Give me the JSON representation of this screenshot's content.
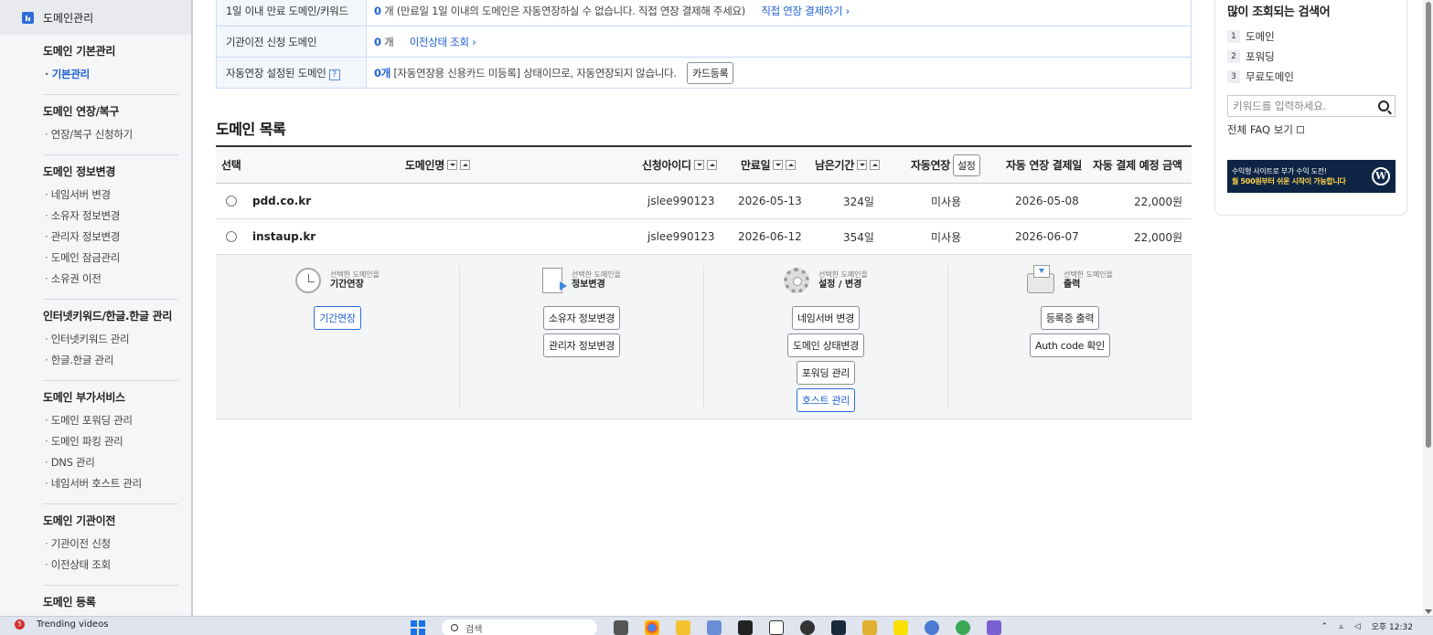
{
  "sidebar": {
    "top_label": "도메인관리",
    "groups": [
      {
        "title": "도메인 기본관리",
        "items": [
          "기본관리"
        ]
      },
      {
        "title": "도메인 연장/복구",
        "items": [
          "연장/복구 신청하기"
        ]
      },
      {
        "title": "도메인 정보변경",
        "items": [
          "네임서버 변경",
          "소유자 정보변경",
          "관리자 정보변경",
          "도메인 잠금관리",
          "소유권 이전"
        ]
      },
      {
        "title": "인터넷키워드/한글.한글 관리",
        "items": [
          "인터넷키워드 관리",
          "한글.한글 관리"
        ]
      },
      {
        "title": "도메인 부가서비스",
        "items": [
          "도메인 포워딩 관리",
          "도메인 파킹 관리",
          "DNS 관리",
          "네임서버 호스트 관리"
        ]
      },
      {
        "title": "도메인 기관이전",
        "items": [
          "기관이전 신청",
          "이전상태 조회"
        ]
      },
      {
        "title": "도메인 등록",
        "items": []
      }
    ]
  },
  "info": {
    "row1": {
      "label": "1일 이내 만료 도메인/키워드",
      "count": "0",
      "unit": "개",
      "text": "(만료일 1일 이내의 도메인은 자동연장하실 수 없습니다. 직접 연장 결제해 주세요)",
      "link": "직접 연장 결제하기"
    },
    "row2": {
      "label": "기관이전 신청 도메인",
      "count": "0",
      "unit": "개",
      "link": "이전상태 조회"
    },
    "row3": {
      "label": "자동연장 설정된 도메인",
      "help": "?",
      "count": "0개",
      "text": "[자동연장용 신용카드 미등록] 상태이므로, 자동연장되지 않습니다.",
      "button": "카드등록"
    }
  },
  "domain_list": {
    "title": "도메인 목록",
    "headers": {
      "select": "선택",
      "domain": "도메인명",
      "applicant": "신청아이디",
      "expiry": "만료일",
      "remaining": "남은기간",
      "auto_renew": "자동연장",
      "auto_renew_btn": "설정",
      "auto_pay_date": "자동 연장 결제일",
      "auto_pay_amount": "자동 결제 예정 금액"
    },
    "rows": [
      {
        "domain": "pdd.co.kr",
        "applicant": "jslee990123",
        "expiry": "2026-05-13",
        "remaining": "324일",
        "auto_renew": "미사용",
        "pay_date": "2026-05-08",
        "amount": "22,000원"
      },
      {
        "domain": "instaup.kr",
        "applicant": "jslee990123",
        "expiry": "2026-06-12",
        "remaining": "354일",
        "auto_renew": "미사용",
        "pay_date": "2026-06-07",
        "amount": "22,000원"
      }
    ]
  },
  "actions": [
    {
      "icon": "clock-icon",
      "caption": "선택한 도메인을",
      "title": "기간연장",
      "buttons": [
        {
          "label": "기간연장",
          "highlight": true
        }
      ]
    },
    {
      "icon": "document-arrow-icon",
      "caption": "선택한 도메인을",
      "title": "정보변경",
      "buttons": [
        {
          "label": "소유자 정보변경"
        },
        {
          "label": "관리자 정보변경"
        }
      ]
    },
    {
      "icon": "gear-icon",
      "caption": "선택한 도메인을",
      "title": "설정 / 변경",
      "buttons": [
        {
          "label": "네임서버 변경"
        },
        {
          "label": "도메인 상태변경"
        },
        {
          "label": "포워딩 관리"
        },
        {
          "label": "호스트 관리",
          "highlight": true
        }
      ]
    },
    {
      "icon": "printer-icon",
      "caption": "선택한 도메인을",
      "title": "출력",
      "buttons": [
        {
          "label": "등록증 출력"
        },
        {
          "label": "Auth code 확인"
        }
      ]
    }
  ],
  "aside": {
    "title": "많이 조회되는 검색어",
    "keywords": [
      {
        "rank": "1",
        "text": "도메인"
      },
      {
        "rank": "2",
        "text": "포워딩"
      },
      {
        "rank": "3",
        "text": "무료도메인"
      }
    ],
    "search_placeholder": "키워드를 입력하세요.",
    "faq_link": "전체 FAQ 보기",
    "banner_line1": "수익형 사이트로 부가 수익 도전!",
    "banner_line2": "월 500원부터 쉬운 시작이 가능합니다",
    "banner_logo": "W"
  },
  "taskbar": {
    "news_badge": "5",
    "news_text": "Trending videos",
    "search_placeholder": "검색",
    "clock": "오후 12:32"
  },
  "colors": {
    "accent": "#1f5fd6",
    "sidebar_bg": "#f5f6f8",
    "banner_bg": "#0d2444"
  }
}
